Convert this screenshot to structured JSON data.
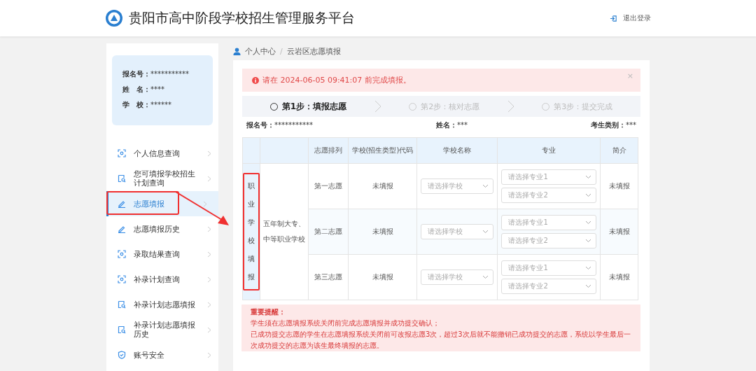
{
  "header": {
    "title": "贵阳市高中阶段学校招生管理服务平台",
    "logout": "退出登录"
  },
  "profile": [
    {
      "label": "报名号：",
      "value": "***********"
    },
    {
      "label": "姓　名：",
      "value": "****"
    },
    {
      "label": "学　校：",
      "value": "******"
    }
  ],
  "sidebar": {
    "items": [
      {
        "label": "个人信息查询",
        "kind": "scan",
        "selected": false,
        "highlighted": false
      },
      {
        "label": "您可填报学校招生计划查询",
        "kind": "doc",
        "selected": false,
        "highlighted": false
      },
      {
        "label": "志愿填报",
        "kind": "pen",
        "selected": true,
        "highlighted": true
      },
      {
        "label": "志愿填报历史",
        "kind": "pen",
        "selected": false,
        "highlighted": false
      },
      {
        "label": "录取结果查询",
        "kind": "scan",
        "selected": false,
        "highlighted": false
      },
      {
        "label": "补录计划查询",
        "kind": "scan",
        "selected": false,
        "highlighted": false
      },
      {
        "label": "补录计划志愿填报",
        "kind": "doc",
        "selected": false,
        "highlighted": false
      },
      {
        "label": "补录计划志愿填报历史",
        "kind": "doc",
        "selected": false,
        "highlighted": false
      },
      {
        "label": "账号安全",
        "kind": "shield",
        "selected": false,
        "highlighted": false
      }
    ]
  },
  "breadcrumb": [
    "个人中心",
    "/",
    "云岩区志愿填报"
  ],
  "alert": {
    "text": "请在 2024-06-05 09:41:07 前完成填报。",
    "close": "×"
  },
  "steps": [
    {
      "label": "第1步：填报志愿",
      "selected": true
    },
    {
      "label": "第2步：核对志愿",
      "selected": false
    },
    {
      "label": "第3步：提交完成",
      "selected": false
    }
  ],
  "info": [
    {
      "label": "报名号：",
      "value": "***********"
    },
    {
      "label": "姓名：",
      "value": "***"
    },
    {
      "label": "考生类别：",
      "value": "***"
    }
  ],
  "table": {
    "columns": [
      "志愿排列",
      "学校(招生类型)代码",
      "学校名称",
      "专业",
      "简介"
    ],
    "group": {
      "label": "职业学校填报",
      "highlighted": true
    },
    "type": "五年制大专、中等职业学校",
    "rows": [
      {
        "rank": "第一志愿",
        "code": "未填报",
        "school_placeholder": "请选择学校",
        "majors": [
          "请选择专业1",
          "请选择专业2"
        ],
        "intro": "未填报"
      },
      {
        "rank": "第二志愿",
        "code": "未填报",
        "school_placeholder": "请选择学校",
        "majors": [
          "请选择专业1",
          "请选择专业2"
        ],
        "intro": "未填报"
      },
      {
        "rank": "第三志愿",
        "code": "未填报",
        "school_placeholder": "请选择学校",
        "majors": [
          "请选择专业1",
          "请选择专业2"
        ],
        "intro": "未填报"
      }
    ]
  },
  "notice": {
    "title": "重要提醒：",
    "lines": [
      "学生须在志愿填报系统关闭前完成志愿填报并成功提交确认；",
      "已成功提交志愿的学生在志愿填报系统关闭前可改报志愿3次，超过3次后就不能撤销已成功提交的志愿，系统以学生最后一次成功提交的志愿为该生最终填报的志愿。"
    ]
  }
}
